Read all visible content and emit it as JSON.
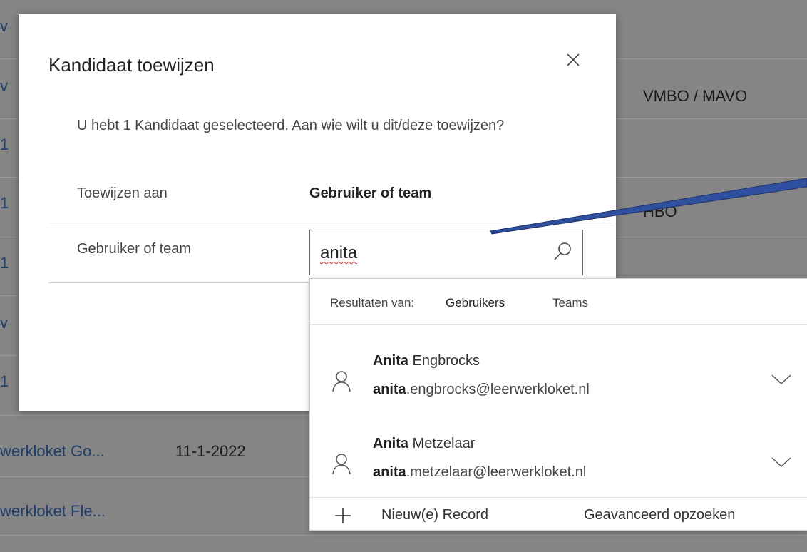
{
  "background": {
    "left_fragments": [
      "v",
      "v",
      "1",
      "1",
      "1",
      "v",
      "1"
    ],
    "education_1": "VMBO / MAVO",
    "education_2": "HBO",
    "row_links": [
      "werkloket Go...",
      "werkloket Fle..."
    ],
    "row_date": "11-1-2022"
  },
  "dialog": {
    "title": "Kandidaat toewijzen",
    "close_icon": "close-icon",
    "message": "U hebt 1 Kandidaat geselecteerd. Aan wie wilt u dit/deze toewijzen?",
    "assign_to_label": "Toewijzen aan",
    "assign_to_value": "Gebruiker of team",
    "user_or_team_label": "Gebruiker of team",
    "search_value": "anita",
    "search_icon": "search-icon"
  },
  "dropdown": {
    "results_from_label": "Resultaten van:",
    "tabs": [
      "Gebruikers",
      "Teams"
    ],
    "results": [
      {
        "name_match": "Anita",
        "name_rest": " Engbrocks",
        "email_match": "anita",
        "email_rest": ".engbrocks@leerwerkloket.nl"
      },
      {
        "name_match": "Anita",
        "name_rest": " Metzelaar",
        "email_match": "anita",
        "email_rest": ".metzelaar@leerwerkloket.nl"
      }
    ],
    "new_record_label": "Nieuw(e) Record",
    "advanced_search_label": "Geavanceerd opzoeken"
  },
  "colors": {
    "overlay": "#858585",
    "link": "#1e3f6e",
    "arrow": "#2f4f9f"
  }
}
